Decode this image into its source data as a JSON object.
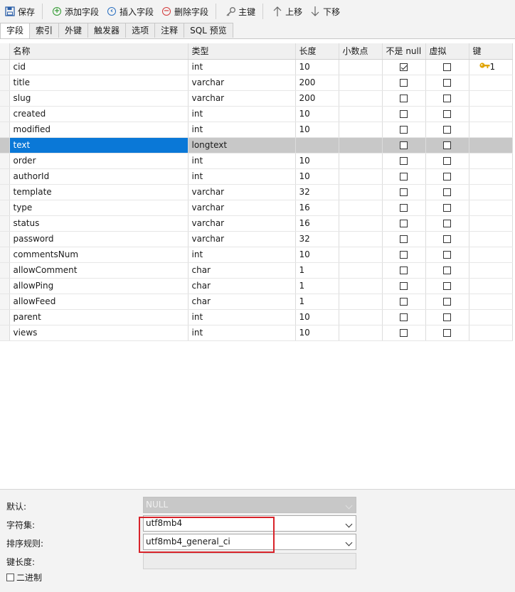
{
  "toolbar": {
    "save": "保存",
    "add_field": "添加字段",
    "insert_field": "插入字段",
    "delete_field": "删除字段",
    "primary_key": "主键",
    "move_up": "上移",
    "move_down": "下移"
  },
  "tabs": [
    {
      "label": "字段",
      "active": true
    },
    {
      "label": "索引"
    },
    {
      "label": "外键"
    },
    {
      "label": "触发器"
    },
    {
      "label": "选项"
    },
    {
      "label": "注释"
    },
    {
      "label": "SQL 预览"
    }
  ],
  "columns": [
    "名称",
    "类型",
    "长度",
    "小数点",
    "不是 null",
    "虚拟",
    "键"
  ],
  "rows": [
    {
      "name": "cid",
      "type": "int",
      "length": "10",
      "not_null": true,
      "key": "1"
    },
    {
      "name": "title",
      "type": "varchar",
      "length": "200"
    },
    {
      "name": "slug",
      "type": "varchar",
      "length": "200"
    },
    {
      "name": "created",
      "type": "int",
      "length": "10"
    },
    {
      "name": "modified",
      "type": "int",
      "length": "10"
    },
    {
      "name": "text",
      "type": "longtext",
      "length": "",
      "selected": true
    },
    {
      "name": "order",
      "type": "int",
      "length": "10"
    },
    {
      "name": "authorId",
      "type": "int",
      "length": "10"
    },
    {
      "name": "template",
      "type": "varchar",
      "length": "32"
    },
    {
      "name": "type",
      "type": "varchar",
      "length": "16"
    },
    {
      "name": "status",
      "type": "varchar",
      "length": "16"
    },
    {
      "name": "password",
      "type": "varchar",
      "length": "32"
    },
    {
      "name": "commentsNum",
      "type": "int",
      "length": "10"
    },
    {
      "name": "allowComment",
      "type": "char",
      "length": "1"
    },
    {
      "name": "allowPing",
      "type": "char",
      "length": "1"
    },
    {
      "name": "allowFeed",
      "type": "char",
      "length": "1"
    },
    {
      "name": "parent",
      "type": "int",
      "length": "10"
    },
    {
      "name": "views",
      "type": "int",
      "length": "10"
    }
  ],
  "props": {
    "default_label": "默认:",
    "default_value": "NULL",
    "charset_label": "字符集:",
    "charset_value": "utf8mb4",
    "collation_label": "排序规则:",
    "collation_value": "utf8mb4_general_ci",
    "key_length_label": "键长度:",
    "binary_label": "二进制"
  },
  "colors": {
    "selection": "#0a78d7",
    "highlight_box": "#d8232a",
    "key": "#e0a400"
  }
}
